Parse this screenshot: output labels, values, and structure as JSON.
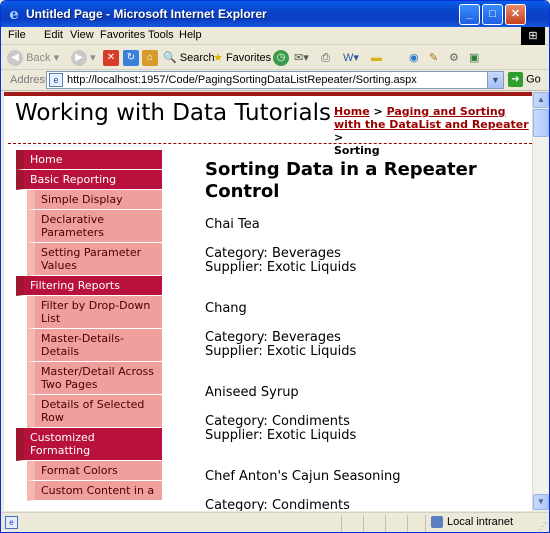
{
  "window": {
    "title": "Untitled Page - Microsoft Internet Explorer",
    "ie_icon": "e",
    "minimize": "_",
    "maximize": "□",
    "close": "✕"
  },
  "menubar": {
    "items": [
      "File",
      "Edit",
      "View",
      "Favorites",
      "Tools",
      "Help"
    ]
  },
  "toolbar": {
    "back": "Back",
    "search": "Search",
    "favorites": "Favorites"
  },
  "addressbar": {
    "label": "Address",
    "url": "http://localhost:1957/Code/PagingSortingDataListRepeater/Sorting.aspx",
    "go": "Go"
  },
  "page": {
    "title": "Working with Data Tutorials",
    "breadcrumb": {
      "home": "Home",
      "sep1": " > ",
      "section": "Paging and Sorting with the DataList and Repeater",
      "sep2": " > ",
      "current": "Sorting"
    },
    "menu": [
      {
        "label": "Home",
        "level": 0
      },
      {
        "label": "Basic Reporting",
        "level": 0
      },
      {
        "label": "Simple Display",
        "level": 1
      },
      {
        "label": "Declarative Parameters",
        "level": 1
      },
      {
        "label": "Setting Parameter Values",
        "level": 1
      },
      {
        "label": "Filtering Reports",
        "level": 0
      },
      {
        "label": "Filter by Drop-Down List",
        "level": 1
      },
      {
        "label": "Master-Details-Details",
        "level": 1
      },
      {
        "label": "Master/Detail Across Two Pages",
        "level": 1
      },
      {
        "label": "Details of Selected Row",
        "level": 1
      },
      {
        "label": "Customized Formatting",
        "level": 0
      },
      {
        "label": "Format Colors",
        "level": 1
      },
      {
        "label": "Custom Content in a",
        "level": 1
      }
    ],
    "heading": "Sorting Data in a Repeater Control",
    "products": [
      {
        "name": "Chai Tea",
        "category": "Category: Beverages",
        "supplier": "Supplier: Exotic Liquids"
      },
      {
        "name": "Chang",
        "category": "Category: Beverages",
        "supplier": "Supplier: Exotic Liquids"
      },
      {
        "name": "Aniseed Syrup",
        "category": "Category: Condiments",
        "supplier": "Supplier: Exotic Liquids"
      },
      {
        "name": "Chef Anton's Cajun Seasoning",
        "category": "Category: Condiments",
        "supplier": ""
      }
    ]
  },
  "statusbar": {
    "zone": "Local intranet"
  },
  "colors": {
    "accent": "#b8123c",
    "submenu": "#f0a09c",
    "link": "#990000"
  }
}
